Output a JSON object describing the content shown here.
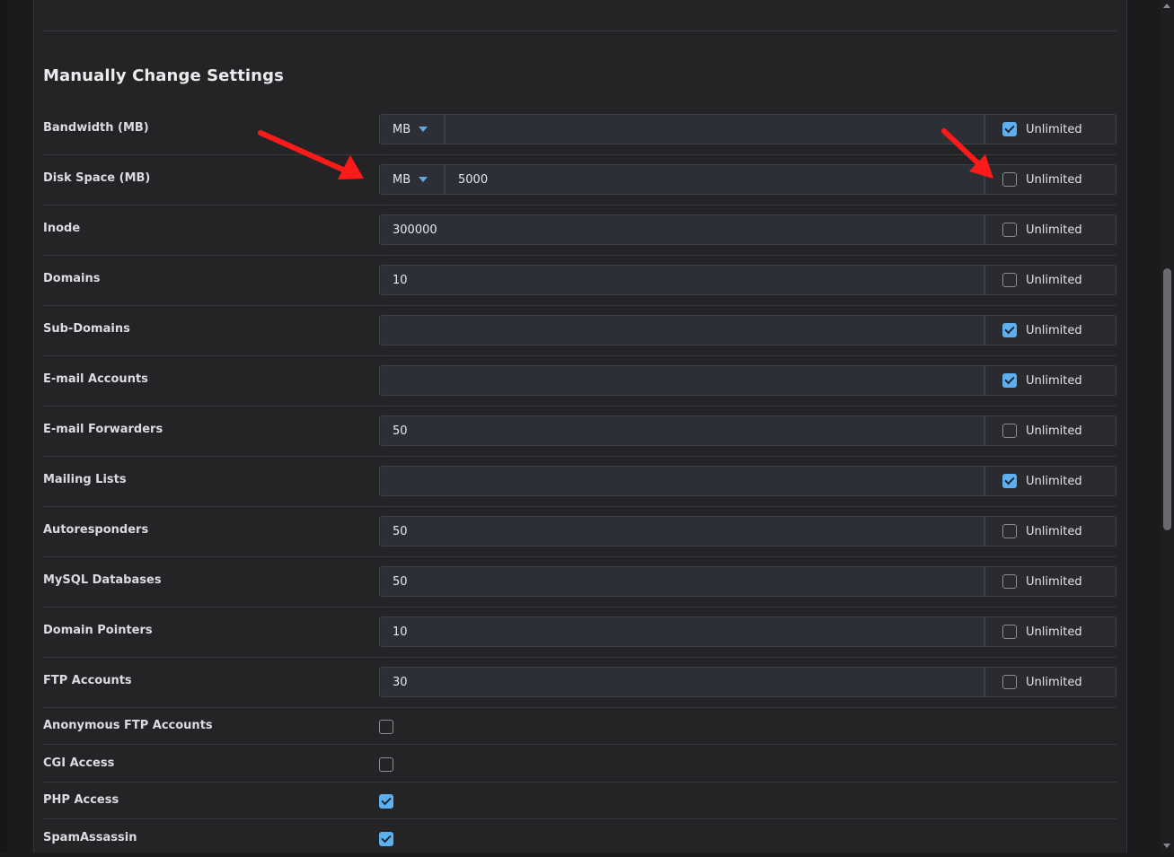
{
  "section": {
    "title": "Manually Change Settings"
  },
  "rows": [
    {
      "label": "Bandwidth (MB)",
      "unit": "MB",
      "value": "",
      "unlimited": true,
      "unlimited_label": "Unlimited"
    },
    {
      "label": "Disk Space (MB)",
      "unit": "MB",
      "value": "5000",
      "unlimited": false,
      "unlimited_label": "Unlimited"
    },
    {
      "label": "Inode",
      "value": "300000",
      "unlimited": false,
      "unlimited_label": "Unlimited"
    },
    {
      "label": "Domains",
      "value": "10",
      "unlimited": false,
      "unlimited_label": "Unlimited"
    },
    {
      "label": "Sub-Domains",
      "value": "",
      "unlimited": true,
      "unlimited_label": "Unlimited"
    },
    {
      "label": "E-mail Accounts",
      "value": "",
      "unlimited": true,
      "unlimited_label": "Unlimited"
    },
    {
      "label": "E-mail Forwarders",
      "value": "50",
      "unlimited": false,
      "unlimited_label": "Unlimited"
    },
    {
      "label": "Mailing Lists",
      "value": "",
      "unlimited": true,
      "unlimited_label": "Unlimited"
    },
    {
      "label": "Autoresponders",
      "value": "50",
      "unlimited": false,
      "unlimited_label": "Unlimited"
    },
    {
      "label": "MySQL Databases",
      "value": "50",
      "unlimited": false,
      "unlimited_label": "Unlimited"
    },
    {
      "label": "Domain Pointers",
      "value": "10",
      "unlimited": false,
      "unlimited_label": "Unlimited"
    },
    {
      "label": "FTP Accounts",
      "value": "30",
      "unlimited": false,
      "unlimited_label": "Unlimited"
    }
  ],
  "toggles": [
    {
      "label": "Anonymous FTP Accounts",
      "checked": false
    },
    {
      "label": "CGI Access",
      "checked": false
    },
    {
      "label": "PHP Access",
      "checked": true
    },
    {
      "label": "SpamAssassin",
      "checked": true
    }
  ],
  "colors": {
    "accent": "#5db0ee",
    "annotation_arrow": "#ff1a1a",
    "background": "#242427"
  }
}
